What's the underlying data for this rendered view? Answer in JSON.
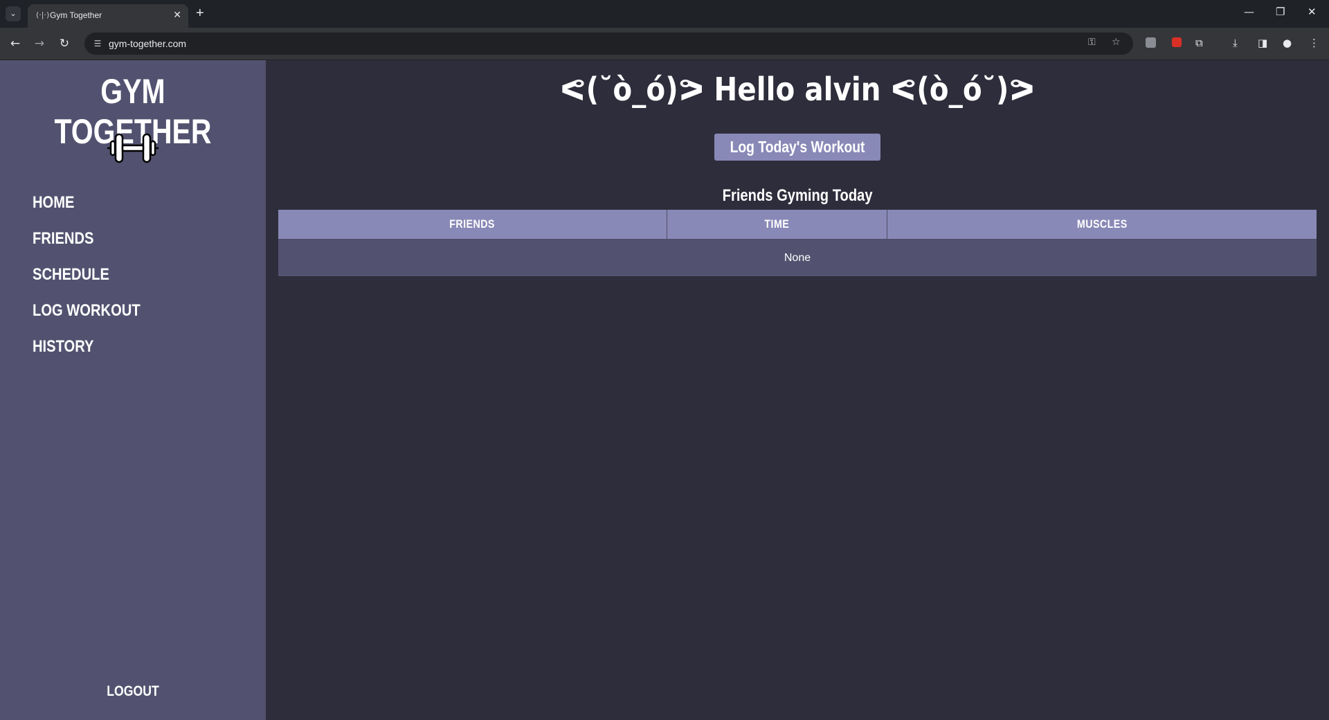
{
  "browser": {
    "tab_title": "Gym Together",
    "tab_favicon": "(·|·)",
    "url": "gym-together.com",
    "icons": [
      "tab-list-icon",
      "close-tab-icon",
      "new-tab-icon",
      "minimize-icon",
      "restore-icon",
      "close-window-icon",
      "back-icon",
      "forward-icon",
      "reload-icon",
      "site-info-icon",
      "password-key-icon",
      "bookmark-star-icon",
      "extension-icon",
      "download-icon",
      "side-panel-icon",
      "profile-icon",
      "menu-icon"
    ]
  },
  "sidebar": {
    "title": "GYM TOGETHER",
    "logo_icon": "dumbbell-icon",
    "nav": [
      {
        "label": "HOME"
      },
      {
        "label": "FRIENDS"
      },
      {
        "label": "SCHEDULE"
      },
      {
        "label": "LOG WORKOUT"
      },
      {
        "label": "HISTORY"
      }
    ],
    "logout": "LOGOUT"
  },
  "main": {
    "greeting": "ᕙ(˘ò_ó)ᕗ Hello alvin ᕙ(ò_ó˘)ᕗ",
    "log_button": "Log Today's Workout",
    "table_title": "Friends Gyming Today",
    "table": {
      "headers": [
        "FRIENDS",
        "TIME",
        "MUSCLES"
      ],
      "empty_text": "None"
    }
  },
  "colors": {
    "sidebar_bg": "#525270",
    "main_bg": "#2e2d3b",
    "accent": "#8989b7",
    "text": "#ffffff"
  }
}
